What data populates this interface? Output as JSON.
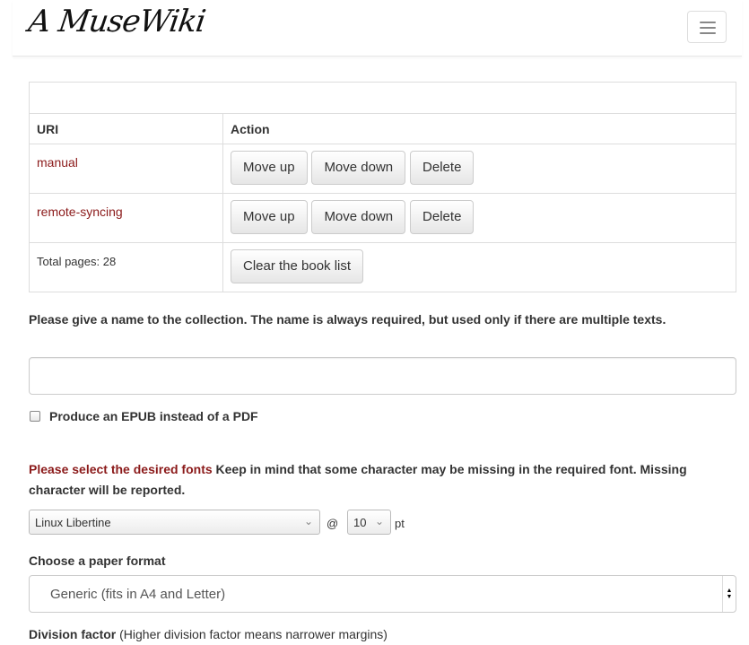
{
  "navbar": {
    "logo": "A MuseWiki",
    "menu_icon": "hamburger-icon"
  },
  "book_table": {
    "headers": {
      "uri": "URI",
      "action": "Action"
    },
    "rows": [
      {
        "uri": "manual",
        "buttons": [
          "Move up",
          "Move down",
          "Delete"
        ]
      },
      {
        "uri": "remote-syncing",
        "buttons": [
          "Move up",
          "Move down",
          "Delete"
        ]
      }
    ],
    "total": "Total pages: 28",
    "clear_button": "Clear the book list"
  },
  "collection": {
    "name_label": "Please give a name to the collection. The name is always required, but used only if there are multiple texts.",
    "name_value": ""
  },
  "epub": {
    "label": "Produce an EPUB instead of a PDF",
    "checked": false
  },
  "fonts": {
    "label_red": "Please select the desired fonts",
    "label_rest": "Keep in mind that some character may be missing in the required font. Missing character will be reported.",
    "font_selected": "Linux Libertine",
    "at": "@",
    "size_selected": "10",
    "unit": "pt"
  },
  "paper": {
    "label": "Choose a paper format",
    "selected": "Generic (fits in A4 and Letter)"
  },
  "division": {
    "label_bold": "Division factor",
    "label_rest": "(Higher division factor means narrower margins)"
  }
}
